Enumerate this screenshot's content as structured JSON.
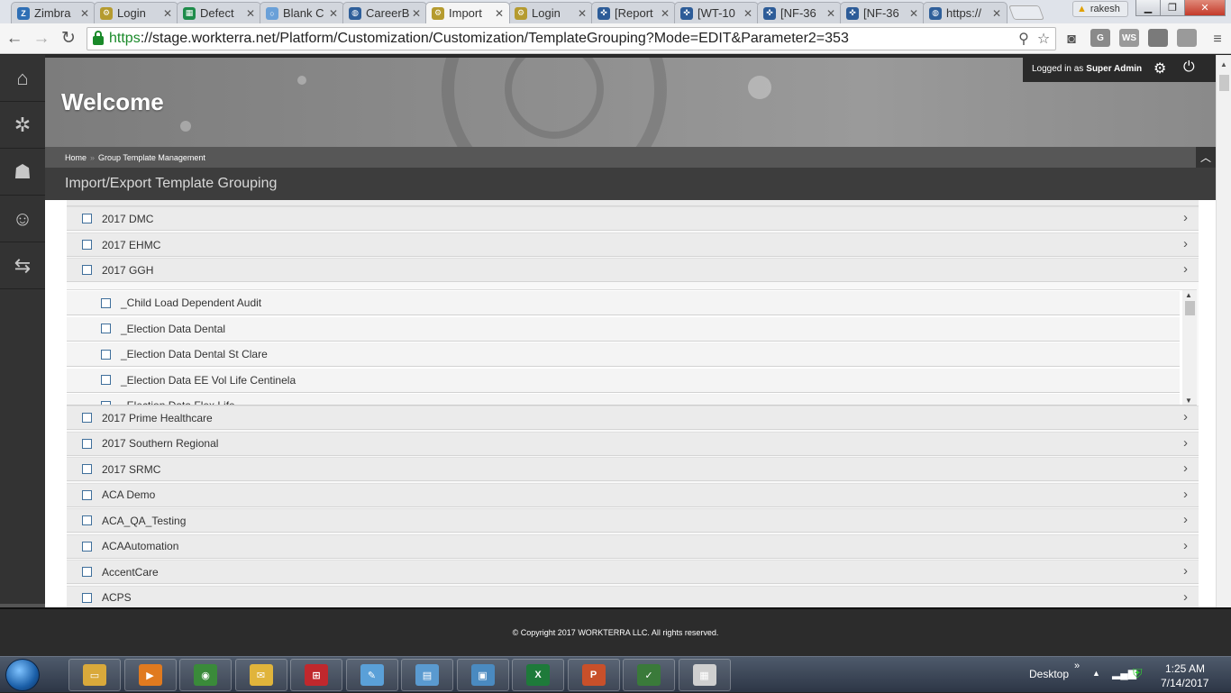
{
  "browser": {
    "tabs": [
      {
        "label": "Zimbra",
        "icon": "zimbra-icon",
        "color": "#2f6fb5",
        "active": false
      },
      {
        "label": "Login",
        "icon": "gear-icon",
        "color": "#b59b2f",
        "active": false
      },
      {
        "label": "Defect",
        "icon": "sheet-icon",
        "color": "#1e8c4a",
        "active": false
      },
      {
        "label": "Blank C",
        "icon": "circle-icon",
        "color": "#6aa0d8",
        "active": false
      },
      {
        "label": "CareerB",
        "icon": "globe-icon",
        "color": "#2f5f9a",
        "active": false
      },
      {
        "label": "Import",
        "icon": "gear-icon",
        "color": "#b59b2f",
        "active": true
      },
      {
        "label": "Login",
        "icon": "gear-icon",
        "color": "#b59b2f",
        "active": false
      },
      {
        "label": "[Report",
        "icon": "jira-icon",
        "color": "#2d5c98",
        "active": false
      },
      {
        "label": "[WT-10",
        "icon": "jira-icon",
        "color": "#2d5c98",
        "active": false
      },
      {
        "label": "[NF-36",
        "icon": "jira-icon",
        "color": "#2d5c98",
        "active": false
      },
      {
        "label": "[NF-36",
        "icon": "jira-icon",
        "color": "#2d5c98",
        "active": false
      },
      {
        "label": "https://",
        "icon": "globe-icon",
        "color": "#2f5f9a",
        "active": false
      }
    ],
    "user": "rakesh",
    "url_scheme": "https",
    "url_rest": "://stage.workterra.net/Platform/Customization/Customization/TemplateGrouping?Mode=EDIT&Parameter2=353",
    "extensions": [
      {
        "label": "G",
        "color": "#8a8a8a"
      },
      {
        "label": "WS",
        "color": "#9a9a9a"
      },
      {
        "label": "",
        "color": "#7a7a7a"
      },
      {
        "label": "",
        "color": "#9a9a9a"
      }
    ]
  },
  "header": {
    "welcome": "Welcome",
    "logged_in_prefix": "Logged in as",
    "logged_in_user": "Super Admin"
  },
  "breadcrumb": {
    "home": "Home",
    "current": "Group Template Management"
  },
  "section_title": "Import/Export Template Grouping",
  "groups_top": [
    "2017 DMC",
    "2017 EHMC",
    "2017 GGH"
  ],
  "sub_items": [
    "_Child Load Dependent Audit",
    "_Election Data Dental",
    "_Election Data Dental St Clare",
    "_Election Data EE Vol Life Centinela",
    "_Election Data Flex Life"
  ],
  "groups_bottom": [
    "2017 Prime Healthcare",
    "2017 Southern Regional",
    "2017 SRMC",
    "ACA Demo",
    "ACA_QA_Testing",
    "ACAAutomation",
    "AccentCare",
    "ACPS"
  ],
  "footer": "© Copyright 2017 WORKTERRA LLC. All rights reserved.",
  "taskbar": {
    "apps": [
      {
        "icon": "explorer-icon",
        "color": "#d9a93b"
      },
      {
        "icon": "media-player-icon",
        "color": "#e07a1f"
      },
      {
        "icon": "chrome-icon",
        "color": "#3a8a3a"
      },
      {
        "icon": "outlook-icon",
        "color": "#e0b43b"
      },
      {
        "icon": "remote-icon",
        "color": "#c0282d"
      },
      {
        "icon": "paint-icon",
        "color": "#5aa0d8"
      },
      {
        "icon": "notebook-icon",
        "color": "#5a9ad0"
      },
      {
        "icon": "image-viewer-icon",
        "color": "#4a8ac0"
      },
      {
        "icon": "excel-icon",
        "color": "#1e7a3a"
      },
      {
        "icon": "powerpoint-icon",
        "color": "#c8502a"
      },
      {
        "icon": "chart-editor-icon",
        "color": "#3a7a3a"
      },
      {
        "icon": "calculator-icon",
        "color": "#cfcfcf"
      }
    ],
    "desktop_label": "Desktop",
    "time": "1:25 AM",
    "date": "7/14/2017"
  }
}
